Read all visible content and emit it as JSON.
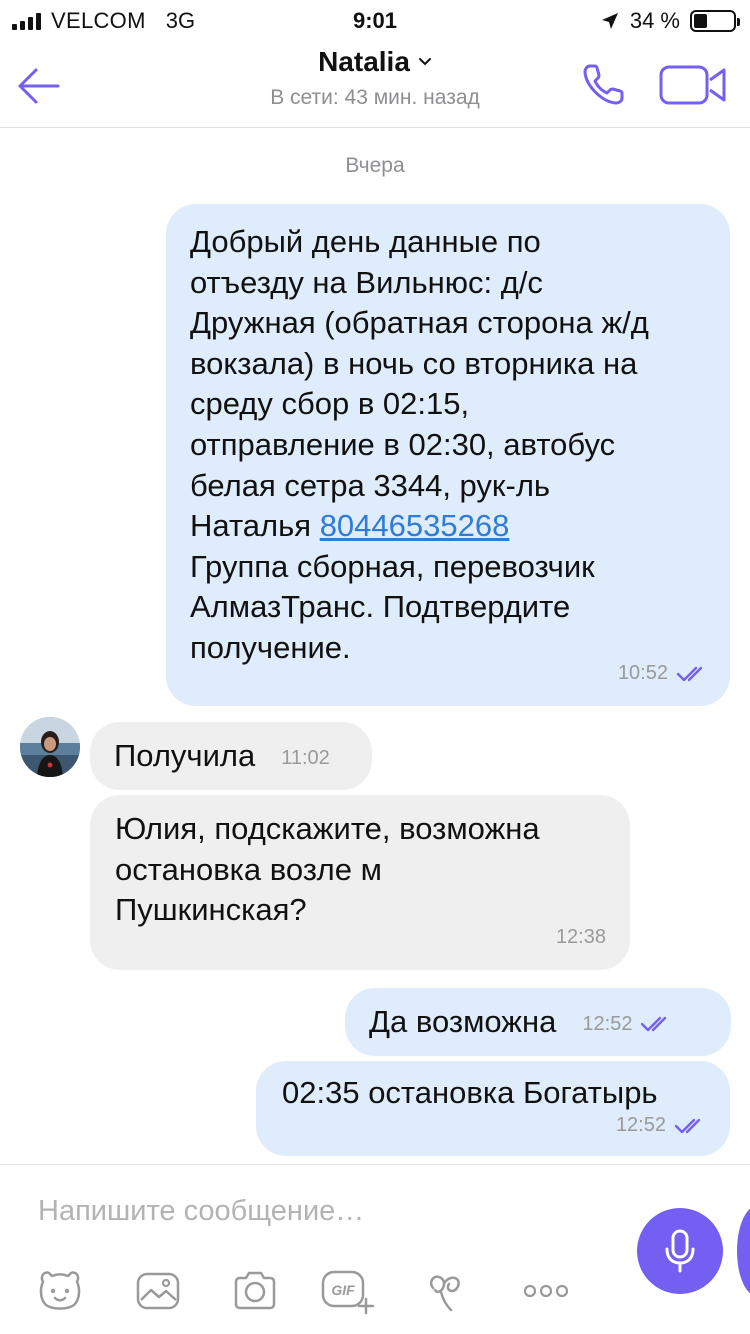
{
  "status_bar": {
    "carrier": "VELCOM",
    "network": "3G",
    "time": "9:01",
    "battery": "34 %",
    "battery_level": 0.34
  },
  "header": {
    "contact_name": "Natalia",
    "status": "В сети: 43 мин. назад"
  },
  "chat": {
    "date_separator": "Вчера",
    "messages": [
      {
        "direction": "outgoing",
        "text_before_link": "Добрый день данные по\nотъезду на Вильнюс: д/с\nДружная (обратная сторона ж/д\nвокзала) в ночь со вторника на\nсреду сбор в 02:15,\nотправление в 02:30, автобус\nбелая сетра 3344, рук-ль\nНаталья ",
        "link": "80446535268",
        "text_after_link": "\nГруппа сборная, перевозчик\nАлмазТранс. Подтвердите\nполучение.",
        "time": "10:52"
      },
      {
        "direction": "incoming",
        "text": "Получила",
        "time": "11:02"
      },
      {
        "direction": "incoming",
        "text": "Юлия, подскажите, возможна\nостановка возле м\nПушкинская?",
        "time": "12:38"
      },
      {
        "direction": "outgoing",
        "text": "Да возможна",
        "time": "12:52"
      },
      {
        "direction": "outgoing",
        "text": "02:35 остановка Богатырь",
        "time": "12:52"
      }
    ]
  },
  "composer": {
    "placeholder": "Напишите сообщение…",
    "tools": [
      "sticker-icon",
      "gallery-icon",
      "camera-icon",
      "gif-icon",
      "doodle-icon",
      "more-icon"
    ]
  },
  "colors": {
    "accent": "#7360f2",
    "outgoing_bubble": "#dfecfb",
    "incoming_bubble": "#efefef",
    "link": "#2f7bd6"
  }
}
